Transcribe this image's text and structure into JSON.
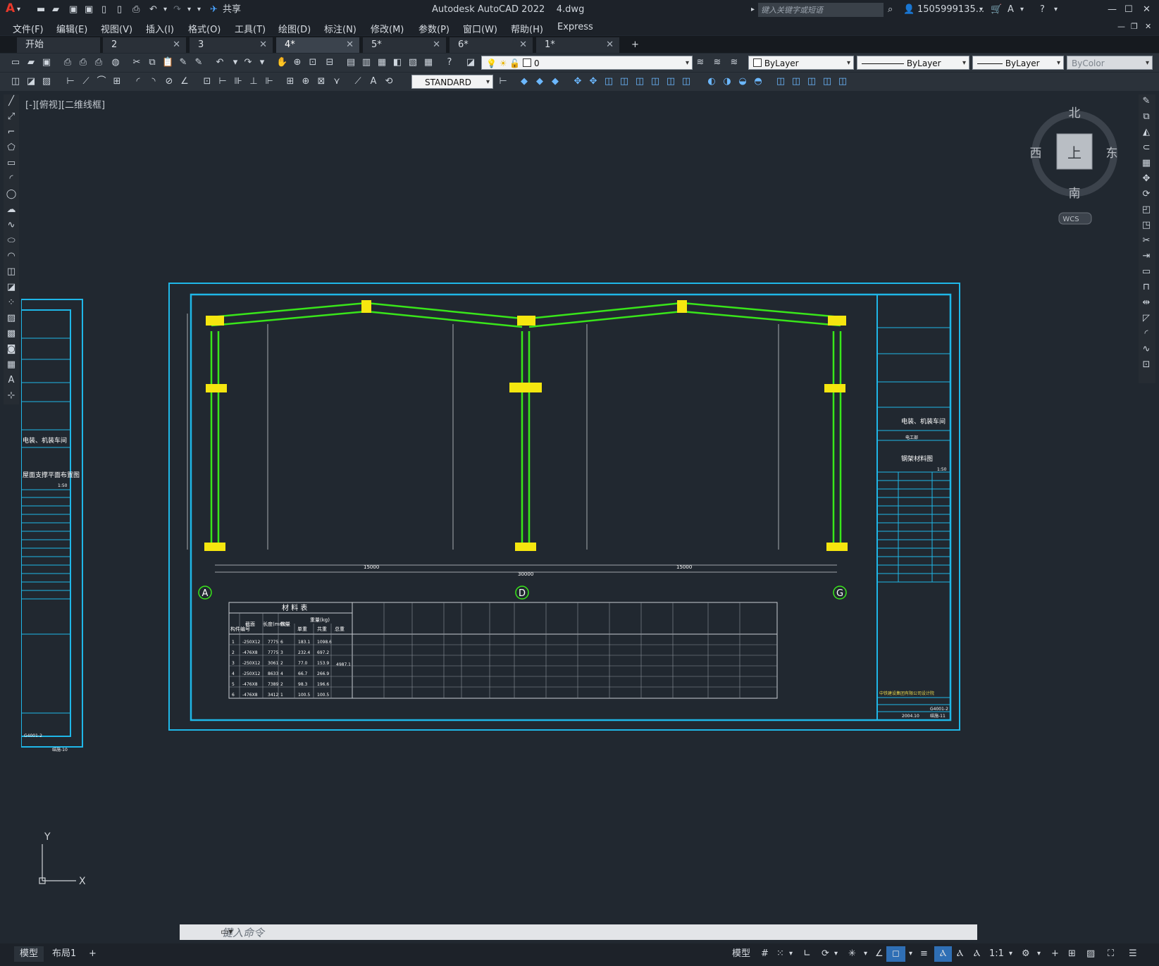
{
  "window": {
    "title": "Autodesk AutoCAD 2022",
    "file": "4.dwg",
    "share_label": "共享",
    "search_placeholder": "键入关键字或短语",
    "user": "1505999135...",
    "controls": [
      "—",
      "☐",
      "✕"
    ]
  },
  "menu": [
    "文件(F)",
    "编辑(E)",
    "视图(V)",
    "插入(I)",
    "格式(O)",
    "工具(T)",
    "绘图(D)",
    "标注(N)",
    "修改(M)",
    "参数(P)",
    "窗口(W)",
    "帮助(H)",
    "Express"
  ],
  "tabs": [
    {
      "label": "开始",
      "active": false
    },
    {
      "label": "2",
      "active": false
    },
    {
      "label": "3",
      "active": false
    },
    {
      "label": "4*",
      "active": true
    },
    {
      "label": "5*",
      "active": false
    },
    {
      "label": "6*",
      "active": false
    },
    {
      "label": "1*",
      "active": false
    }
  ],
  "toolbar": {
    "layer_value": "0",
    "color_value": "ByLayer",
    "linetype_value": "ByLayer",
    "lineweight_value": "ByLayer",
    "plotstyle_value": "ByColor",
    "textstyle_value": "STANDARD"
  },
  "viewport": {
    "label": "[-][俯视][二维线框]",
    "compass": {
      "north": "北",
      "south": "南",
      "east": "东",
      "west": "西",
      "center": "上",
      "wcs": "WCS"
    },
    "ucs": {
      "x": "X",
      "y": "Y"
    }
  },
  "drawing": {
    "axis_labels": [
      "A",
      "D",
      "G"
    ],
    "dim_total": "30000",
    "dim_half": [
      "15000",
      "15000"
    ],
    "table_title": "材  料  表",
    "table_col_headers": [
      "构件编号",
      "截面",
      "长度(mm)",
      "数量",
      "重量(kg)",
      "单重",
      "共重",
      "总重"
    ],
    "table_rows": [
      [
        "1",
        "-250X12",
        "7775",
        "6",
        "183.1",
        "1098.6"
      ],
      [
        "2",
        "-476X8",
        "7775",
        "3",
        "232.4",
        "697.2"
      ],
      [
        "3",
        "-250X12",
        "3061",
        "2",
        "77.0",
        "153.9"
      ],
      [
        "4",
        "-250X12",
        "8633",
        "4",
        "66.7",
        "266.9"
      ],
      [
        "5",
        "-476X8",
        "7389",
        "2",
        "98.3",
        "196.6"
      ],
      [
        "6",
        "-476X8",
        "3412",
        "1",
        "100.5",
        "100.5"
      ]
    ],
    "table_total": "4987.1",
    "titleblock": {
      "project": "电装、机装车间",
      "sheet_name": "钢架材料图",
      "scale": "1:50",
      "drawing_no": "G4001-2",
      "sheet_no": "结施-11",
      "date": "2004.10",
      "company": "中铁建设集团有限公司设计院",
      "sub": "电工部"
    },
    "side_sheet": {
      "project": "电装、机装车间",
      "title": "屋面支撑平面布置图",
      "scale": "1:50",
      "drawing_no": "G4001-2",
      "sheet_no": "结施-10"
    }
  },
  "command": {
    "placeholder": "键入命令"
  },
  "status": {
    "layout_tabs": [
      "模型",
      "布局1"
    ],
    "model_label": "模型",
    "scale": "1:1"
  }
}
